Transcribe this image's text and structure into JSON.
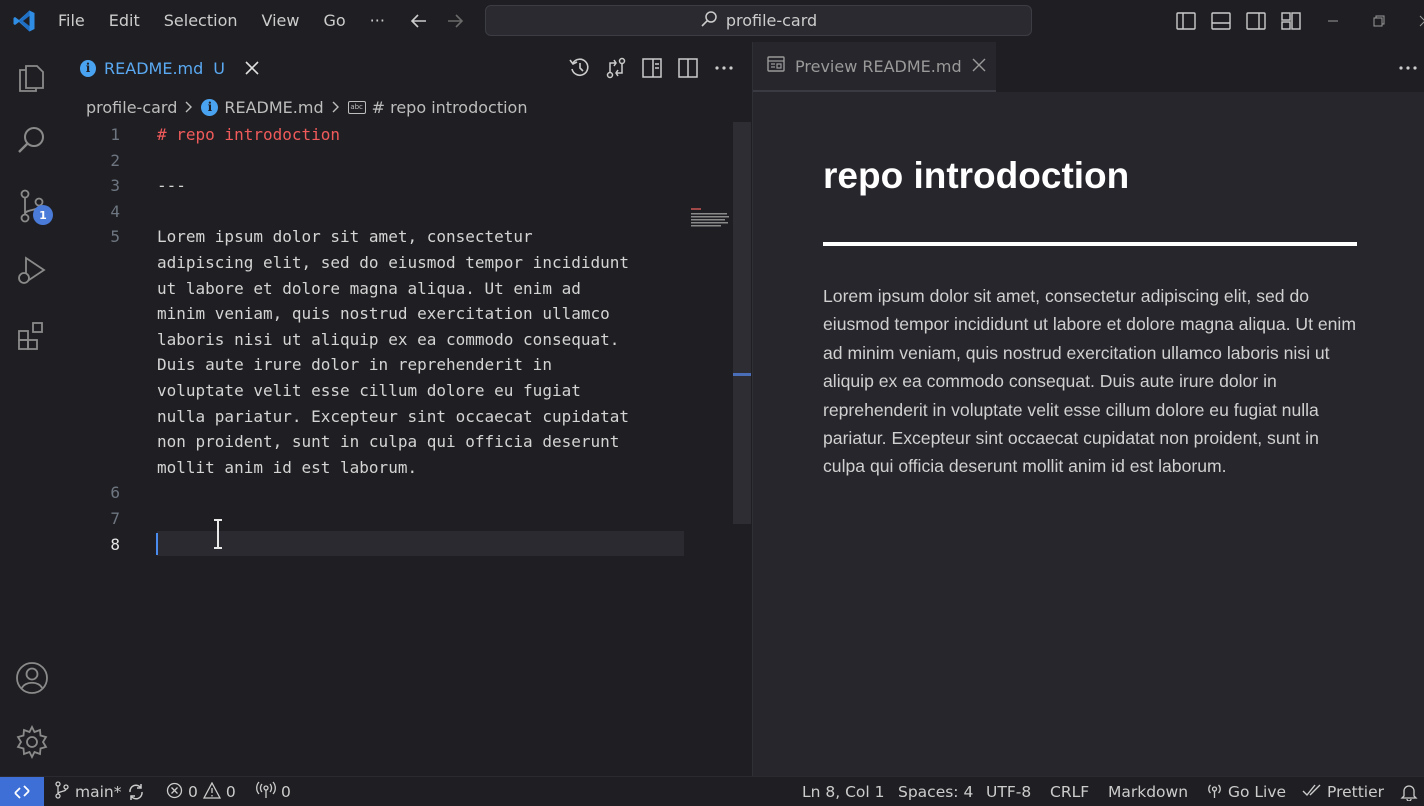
{
  "menu": [
    "File",
    "Edit",
    "Selection",
    "View",
    "Go",
    "···"
  ],
  "search": {
    "text": "profile-card"
  },
  "editor": {
    "tab": {
      "label": "README.md",
      "status": "U"
    },
    "breadcrumb": {
      "folder": "profile-card",
      "file": "README.md",
      "symbol": "# repo introdoction"
    },
    "lines": [
      {
        "num": "1",
        "text": "# repo introdoction",
        "kind": "heading"
      },
      {
        "num": "2",
        "text": ""
      },
      {
        "num": "3",
        "text": "---"
      },
      {
        "num": "4",
        "text": ""
      },
      {
        "num": "5",
        "text": "Lorem ipsum dolor sit amet, consectetur"
      },
      {
        "num": "",
        "text": "adipiscing elit, sed do eiusmod tempor incididunt"
      },
      {
        "num": "",
        "text": "ut labore et dolore magna aliqua. Ut enim ad"
      },
      {
        "num": "",
        "text": "minim veniam, quis nostrud exercitation ullamco"
      },
      {
        "num": "",
        "text": "laboris nisi ut aliquip ex ea commodo consequat."
      },
      {
        "num": "",
        "text": "Duis aute irure dolor in reprehenderit in"
      },
      {
        "num": "",
        "text": "voluptate velit esse cillum dolore eu fugiat"
      },
      {
        "num": "",
        "text": "nulla pariatur. Excepteur sint occaecat cupidatat"
      },
      {
        "num": "",
        "text": "non proident, sunt in culpa qui officia deserunt"
      },
      {
        "num": "",
        "text": "mollit anim id est laborum."
      },
      {
        "num": "6",
        "text": ""
      },
      {
        "num": "7",
        "text": ""
      },
      {
        "num": "8",
        "text": "",
        "active": true
      }
    ]
  },
  "preview": {
    "tab_label": "Preview README.md",
    "heading": "repo introdoction",
    "paragraph": "Lorem ipsum dolor sit amet, consectetur adipiscing elit, sed do eiusmod tempor incididunt ut labore et dolore magna aliqua. Ut enim ad minim veniam, quis nostrud exercitation ullamco laboris nisi ut aliquip ex ea commodo consequat. Duis aute irure dolor in reprehenderit in voluptate velit esse cillum dolore eu fugiat nulla pariatur. Excepteur sint occaecat cupidatat non proident, sunt in culpa qui officia deserunt mollit anim id est laborum."
  },
  "activity": {
    "scm_badge": "1"
  },
  "status": {
    "branch": "main*",
    "errors": "0",
    "warnings": "0",
    "ports": "0",
    "position": "Ln 8, Col 1",
    "spaces": "Spaces: 4",
    "encoding": "UTF-8",
    "eol": "CRLF",
    "language": "Markdown",
    "golive": "Go Live",
    "prettier": "Prettier"
  },
  "colors": {
    "accent": "#3d6fd6",
    "heading": "#f05a5a",
    "tab_label": "#5aa9f2"
  },
  "icons": [
    "vscode-logo",
    "explorer-icon",
    "search-icon",
    "source-control-icon",
    "run-debug-icon",
    "extensions-icon",
    "account-icon",
    "settings-gear-icon"
  ]
}
